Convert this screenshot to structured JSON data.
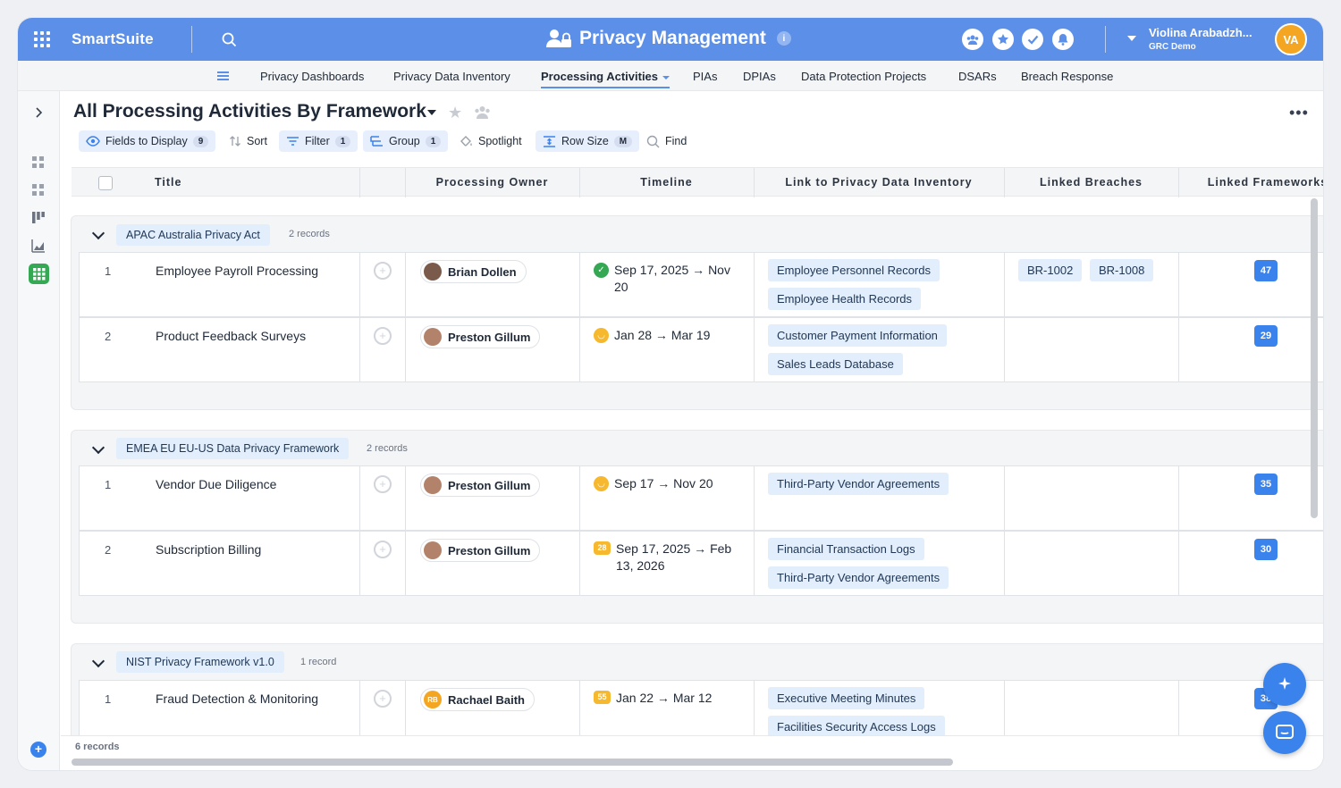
{
  "topbar": {
    "brand": "SmartSuite",
    "app_title": "Privacy Management",
    "info": "i",
    "user_name": "Violina Arabadzh...",
    "user_org": "GRC Demo",
    "user_initials": "VA",
    "accent": "#5b8fe8"
  },
  "nav": {
    "items": [
      "Privacy Dashboards",
      "Privacy Data Inventory",
      "Processing Activities",
      "PIAs",
      "DPIAs",
      "Data Protection Projects",
      "DSARs",
      "Breach Response"
    ],
    "active": "Processing Activities"
  },
  "view": {
    "title": "All Processing Activities By Framework",
    "toolbar": {
      "fields": "Fields to Display",
      "fields_count": "9",
      "sort": "Sort",
      "filter": "Filter",
      "filter_count": "1",
      "group": "Group",
      "group_count": "1",
      "spotlight": "Spotlight",
      "row_size": "Row Size",
      "row_size_value": "M",
      "find": "Find"
    }
  },
  "columns": [
    "Title",
    "Processing Owner",
    "Timeline",
    "Link to Privacy Data Inventory",
    "Linked Breaches",
    "Linked Frameworks"
  ],
  "groups": [
    {
      "label": "APAC Australia Privacy Act",
      "count": "2 records",
      "rows": [
        {
          "num": "1",
          "title": "Employee Payroll Processing",
          "owner": "Brian Dollen",
          "timeline": "Sep 17, 2025 → Nov 20",
          "status": "check",
          "inventory": [
            "Employee Personnel Records",
            "Employee Health Records"
          ],
          "breaches": [
            "BR-1002",
            "BR-1008"
          ],
          "framework": "47"
        },
        {
          "num": "2",
          "title": "Product Feedback Surveys",
          "owner": "Preston Gillum",
          "timeline": "Jan 28 → Mar 19",
          "status": "smile",
          "inventory": [
            "Customer Payment Information",
            "Sales Leads Database"
          ],
          "breaches": [],
          "framework": "29"
        }
      ]
    },
    {
      "label": "EMEA EU EU-US Data Privacy Framework",
      "count": "2 records",
      "rows": [
        {
          "num": "1",
          "title": "Vendor Due Diligence",
          "owner": "Preston Gillum",
          "timeline": "Sep 17 → Nov 20",
          "status": "smile",
          "inventory": [
            "Third-Party Vendor Agreements"
          ],
          "breaches": [],
          "framework": "35"
        },
        {
          "num": "2",
          "title": "Subscription Billing",
          "owner": "Preston Gillum",
          "timeline": "Sep 17, 2025 → Feb 13, 2026",
          "status": "28",
          "inventory": [
            "Financial Transaction Logs",
            "Third-Party Vendor Agreements"
          ],
          "breaches": [],
          "framework": "30"
        }
      ]
    },
    {
      "label": "NIST Privacy Framework v1.0",
      "count": "1 record",
      "rows": [
        {
          "num": "1",
          "title": "Fraud Detection & Monitoring",
          "owner": "Rachael Baith",
          "owner_initials": "RB",
          "timeline": "Jan 22 → Mar 12",
          "status": "55",
          "inventory": [
            "Executive Meeting Minutes",
            "Facilities Security Access Logs"
          ],
          "breaches": [],
          "framework": "38"
        }
      ]
    }
  ],
  "footer": {
    "records": "6 records"
  }
}
